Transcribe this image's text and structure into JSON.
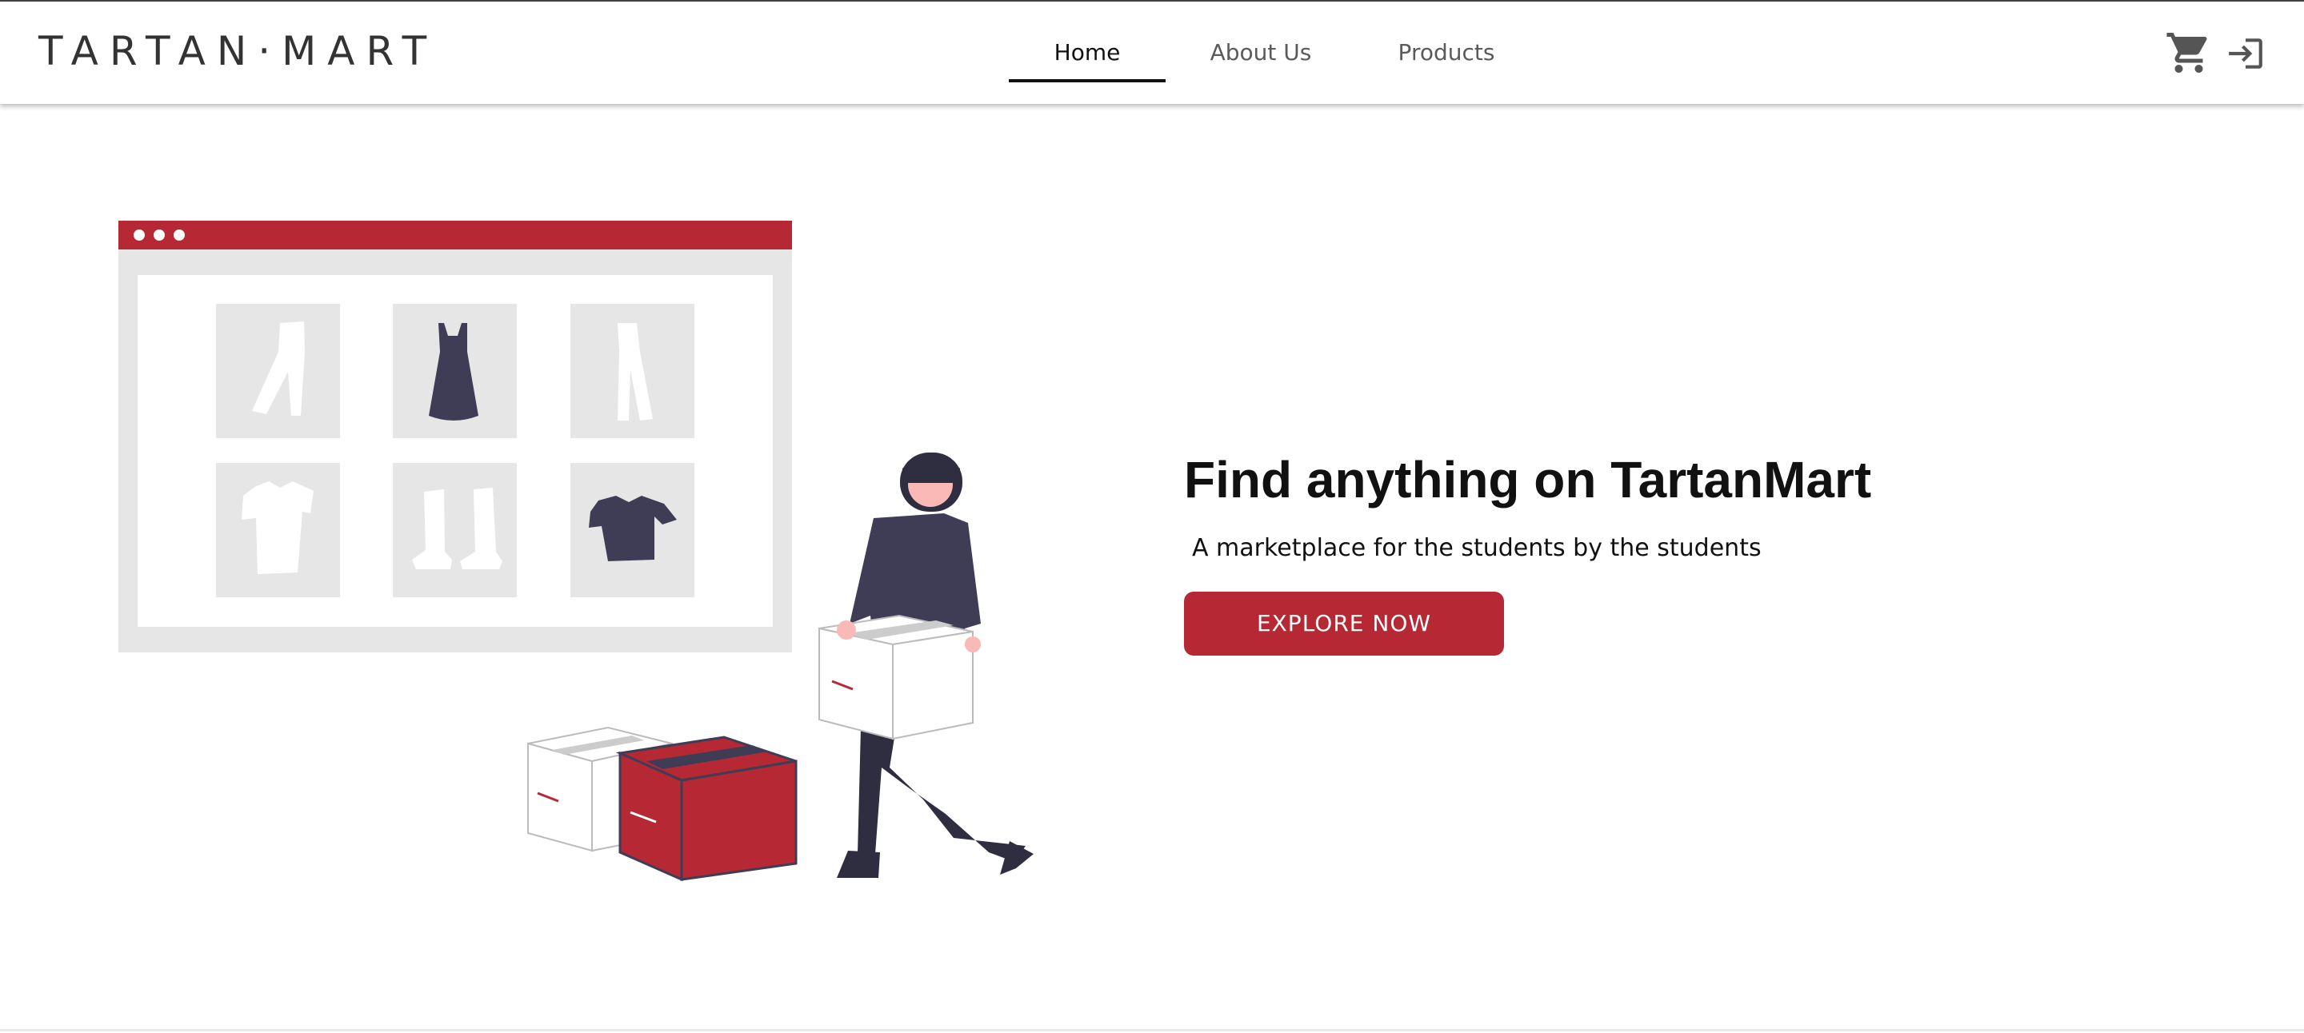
{
  "header": {
    "logo": "TARTAN·MART",
    "nav": [
      {
        "label": "Home",
        "active": true
      },
      {
        "label": "About Us",
        "active": false
      },
      {
        "label": "Products",
        "active": false
      }
    ],
    "icons": {
      "cart": "cart-icon",
      "login": "login-icon"
    }
  },
  "hero": {
    "title": "Find anything on TartanMart",
    "subtitle": "A marketplace for the students by the students",
    "cta_label": "EXPLORE NOW",
    "illustration": "shopping-illustration"
  },
  "colors": {
    "brand_red": "#b52834",
    "dark_navy": "#3f3d56",
    "panel_gray": "#e6e6e6"
  }
}
